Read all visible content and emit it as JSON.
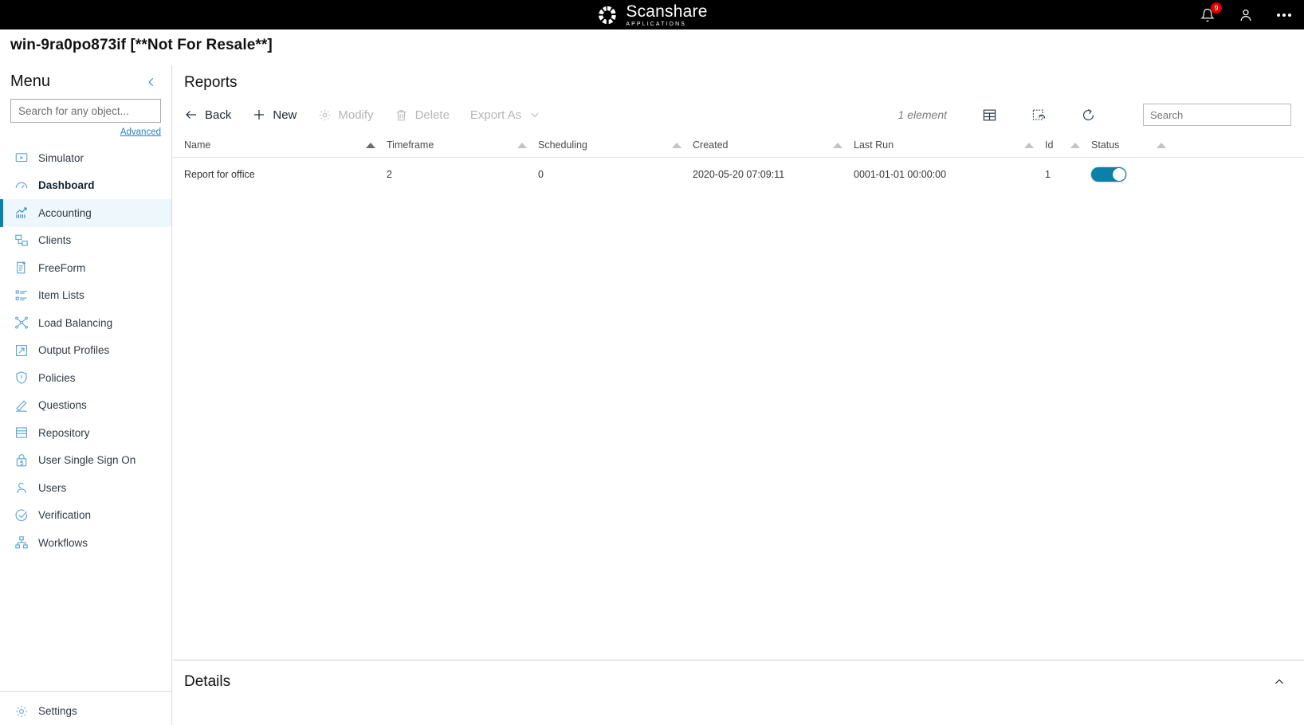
{
  "topbar": {
    "brand_name": "Scanshare",
    "brand_sub": "APPLICATIONS",
    "notification_count": "9",
    "icons": {
      "bell": "bell-icon",
      "user": "user-icon",
      "more": "more-icon"
    }
  },
  "machine": {
    "title": "win-9ra0po873if [**Not For Resale**]"
  },
  "sidebar": {
    "title": "Menu",
    "collapse_icon": "chevron-left-icon",
    "search": {
      "placeholder": "Search for any object...",
      "value": "",
      "icon": "search-icon"
    },
    "advanced_label": "Advanced",
    "items": [
      {
        "label": "Simulator",
        "icon": "simulator-icon",
        "state": "normal"
      },
      {
        "label": "Dashboard",
        "icon": "dashboard-icon",
        "state": "bold"
      },
      {
        "label": "Accounting",
        "icon": "accounting-icon",
        "state": "active"
      },
      {
        "label": "Clients",
        "icon": "clients-icon",
        "state": "normal"
      },
      {
        "label": "FreeForm",
        "icon": "freeform-icon",
        "state": "normal"
      },
      {
        "label": "Item Lists",
        "icon": "item-lists-icon",
        "state": "normal"
      },
      {
        "label": "Load Balancing",
        "icon": "load-balancing-icon",
        "state": "normal"
      },
      {
        "label": "Output Profiles",
        "icon": "output-profiles-icon",
        "state": "normal"
      },
      {
        "label": "Policies",
        "icon": "policies-icon",
        "state": "normal"
      },
      {
        "label": "Questions",
        "icon": "questions-icon",
        "state": "normal"
      },
      {
        "label": "Repository",
        "icon": "repository-icon",
        "state": "normal"
      },
      {
        "label": "User Single Sign On",
        "icon": "user-sso-icon",
        "state": "normal"
      },
      {
        "label": "Users",
        "icon": "users-icon",
        "state": "normal"
      },
      {
        "label": "Verification",
        "icon": "verification-icon",
        "state": "normal"
      },
      {
        "label": "Workflows",
        "icon": "workflows-icon",
        "state": "normal"
      }
    ],
    "settings_label": "Settings",
    "settings_icon": "gear-icon"
  },
  "main": {
    "page_title": "Reports",
    "toolbar": {
      "back_label": "Back",
      "new_label": "New",
      "modify_label": "Modify",
      "delete_label": "Delete",
      "export_label": "Export As",
      "count_label": "1 element",
      "icons": {
        "back": "arrow-left-icon",
        "new": "plus-icon",
        "modify": "gear-icon",
        "delete": "trash-icon",
        "export_chevron": "chevron-down-icon",
        "columns": "table-grid-icon",
        "reset_selection": "reset-selection-icon",
        "refresh": "refresh-icon"
      },
      "search": {
        "placeholder": "Search",
        "value": "",
        "icon": "search-icon"
      }
    },
    "table": {
      "columns": [
        {
          "label": "Name",
          "sorted": true
        },
        {
          "label": "Timeframe",
          "sorted": false
        },
        {
          "label": "Scheduling",
          "sorted": false
        },
        {
          "label": "Created",
          "sorted": false
        },
        {
          "label": "Last Run",
          "sorted": false
        },
        {
          "label": "Id",
          "sorted": false
        },
        {
          "label": "Status",
          "sorted": false
        }
      ],
      "rows": [
        {
          "name": "Report for office",
          "timeframe": "2",
          "scheduling": "0",
          "created": "2020-05-20 07:09:11",
          "last_run": "0001-01-01 00:00:00",
          "id": "1",
          "status_enabled": true
        }
      ]
    },
    "details": {
      "title": "Details",
      "collapse_icon": "chevron-up-icon"
    }
  },
  "colors": {
    "accent_teal": "#0a81a8",
    "icon_blue": "#5ba4cf",
    "link_blue": "#2a7fc0",
    "badge_red": "#e00000",
    "topbar_black": "#000000"
  }
}
